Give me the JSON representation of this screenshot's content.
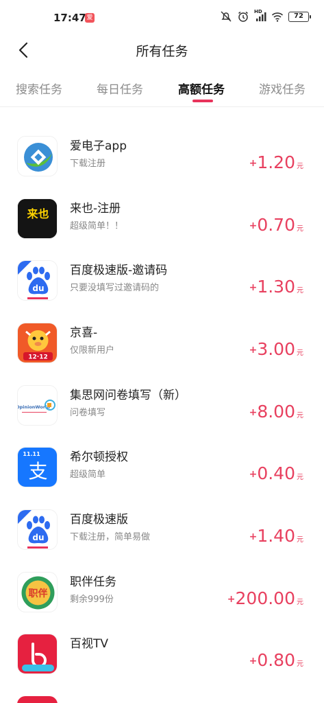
{
  "status_bar": {
    "time": "17:47",
    "app_badge": "爱",
    "battery": "72",
    "hd": "HD"
  },
  "header": {
    "title": "所有任务"
  },
  "tabs": [
    {
      "label": "搜索任务",
      "active": false
    },
    {
      "label": "每日任务",
      "active": false
    },
    {
      "label": "高额任务",
      "active": true
    },
    {
      "label": "游戏任务",
      "active": false
    }
  ],
  "colors": {
    "accent": "#e8335b",
    "reward": "#e8405f"
  },
  "tasks": [
    {
      "name": "爱电子app",
      "desc": "下载注册",
      "plus": "+",
      "reward": "1.20",
      "unit": "元",
      "icon": "aidianzi-app-icon"
    },
    {
      "name": "来也-注册",
      "desc": "超级简单！！",
      "plus": "+",
      "reward": "0.70",
      "unit": "元",
      "icon": "laiye-app-icon",
      "icon_text": "来也"
    },
    {
      "name": "百度极速版-邀请码",
      "desc": "只要没填写过邀请码的",
      "plus": "+",
      "reward": "1.30",
      "unit": "元",
      "icon": "baidu-lite-app-icon",
      "icon_text": "du",
      "icon_tag": "极速"
    },
    {
      "name": "京喜-",
      "desc": "仅限新用户",
      "plus": "+",
      "reward": "3.00",
      "unit": "元",
      "icon": "jingxi-app-icon",
      "icon_text": "12·12"
    },
    {
      "name": "集思网问卷填写（新）",
      "desc": "问卷填写",
      "plus": "+",
      "reward": "8.00",
      "unit": "元",
      "icon": "opinionworld-app-icon",
      "icon_text": "OpinionWorld"
    },
    {
      "name": "希尔顿授权",
      "desc": "超级简单",
      "plus": "+",
      "reward": "0.40",
      "unit": "元",
      "icon": "alipay-app-icon",
      "icon_text": "支",
      "icon_tag": "11.11"
    },
    {
      "name": "百度极速版",
      "desc": "下载注册，简单易做",
      "plus": "+",
      "reward": "1.40",
      "unit": "元",
      "icon": "baidu-lite-app-icon",
      "icon_text": "du",
      "icon_tag": "极速"
    },
    {
      "name": "职伴任务",
      "desc": "剩余999份",
      "plus": "+",
      "reward": "200.00",
      "unit": "元",
      "icon": "zhiban-app-icon",
      "icon_text": "职伴"
    },
    {
      "name": "百视TV",
      "desc": "",
      "plus": "+",
      "reward": "0.80",
      "unit": "元",
      "icon": "baishi-tv-app-icon"
    }
  ]
}
